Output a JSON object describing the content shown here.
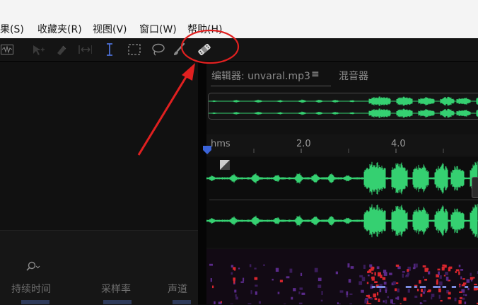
{
  "menu": {
    "effects": "效果(S)",
    "favorites": "收藏夹(R)",
    "view": "视图(V)",
    "window": "窗口(W)",
    "help": "帮助(H)"
  },
  "toolbar": {
    "tools": [
      "waveform-view-icon",
      "move-tool-icon",
      "razor-tool-icon",
      "slip-tool-icon",
      "time-selection-tool-icon",
      "marquee-selection-tool-icon",
      "lasso-selection-tool-icon",
      "brush-selection-tool-icon",
      "spot-healing-brush-tool-icon"
    ],
    "highlighted_tool": "spot-healing-brush-tool-icon"
  },
  "editor": {
    "tab_label": "编辑器: unvaral.mp3",
    "menu_glyph": "≡",
    "mixer_tab": "混音器",
    "ruler": {
      "unit": "hms",
      "ticks": [
        "2.0",
        "4.0"
      ]
    }
  },
  "files_panel": {
    "columns": [
      "持续时间",
      "采样率",
      "声道"
    ]
  },
  "colors": {
    "waveform": "#35d071",
    "annotation": "#e02020",
    "menubar": "#f4f4f4",
    "background": "#0c0c0c"
  }
}
